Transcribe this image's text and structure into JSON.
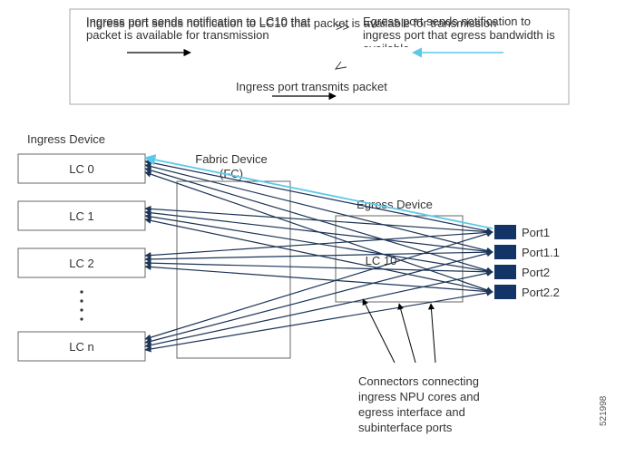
{
  "legend": {
    "step1": "Ingress port sends notification to LC10 that packet is available for transmission",
    "step2": "Egress port sends notification to ingress port that egress bandwidth is available",
    "step3": "Ingress port transmits packet",
    "sep": ">>"
  },
  "labels": {
    "ingress_device": "Ingress Device",
    "fabric_device_line1": "Fabric Device",
    "fabric_device_line2": "(FC)",
    "egress_device": "Egress Device",
    "lc0": "LC 0",
    "lc1": "LC 1",
    "lc2": "LC 2",
    "lcn": "LC n",
    "lc10": "LC 10",
    "port1": "Port1",
    "port1_1": "Port1.1",
    "port2": "Port2",
    "port2_2": "Port2.2",
    "connectors_line1": "Connectors connecting",
    "connectors_line2": "ingress NPU cores  and",
    "connectors_line3": "egress  interface and",
    "connectors_line4": "subinterface ports",
    "doc_id": "521998"
  },
  "colors": {
    "border": "#a8a8a8",
    "dark_line": "#1d3557",
    "cyan": "#5cc9ea",
    "port_fill": "#123466",
    "box_stroke": "#676767",
    "black": "#000000"
  }
}
